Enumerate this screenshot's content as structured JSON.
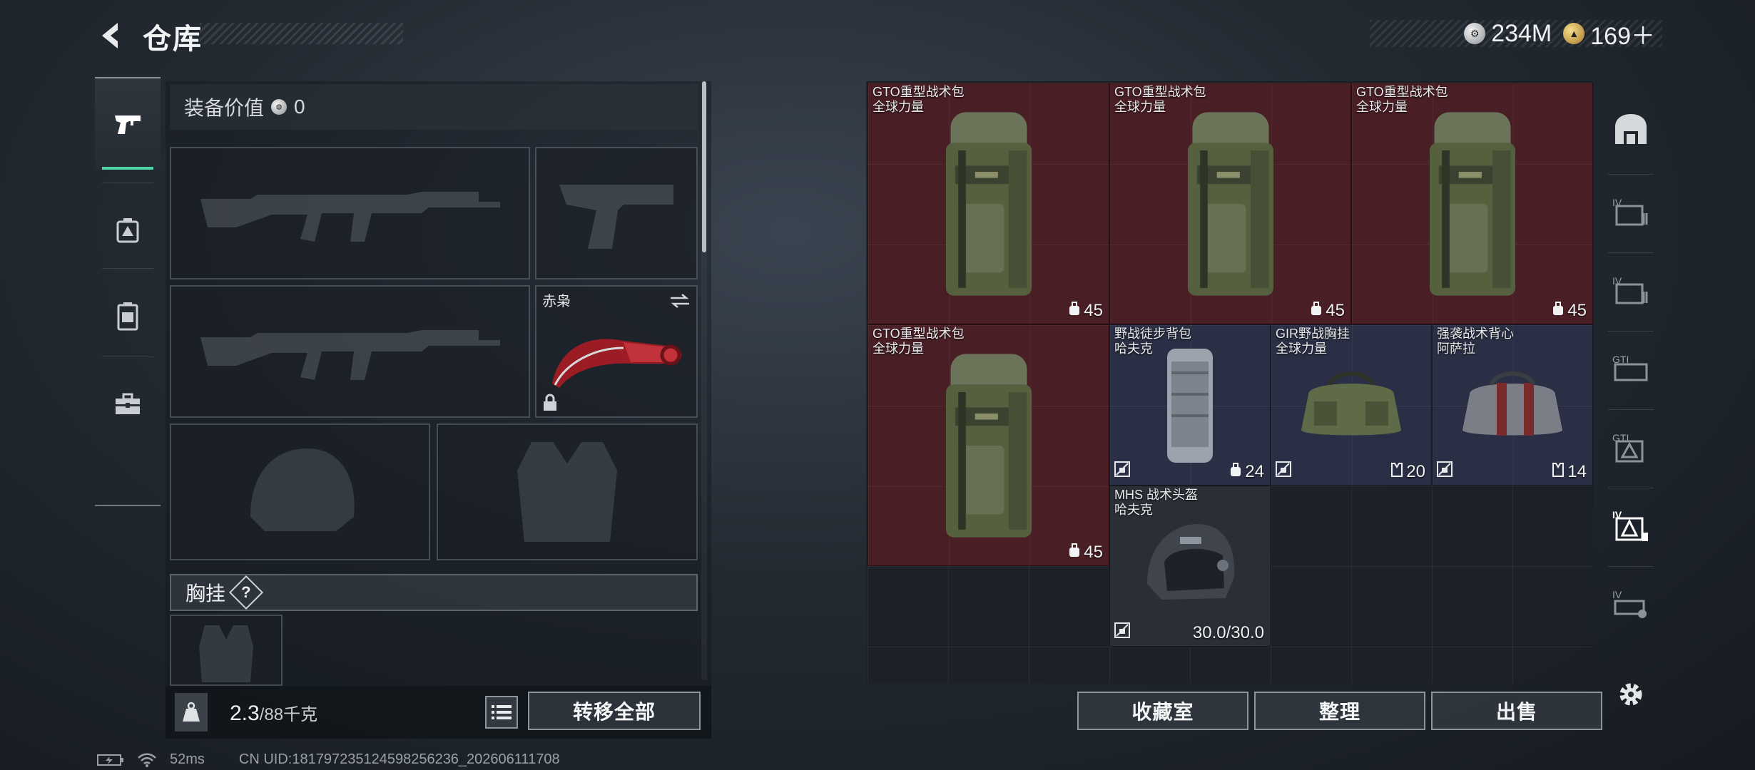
{
  "header": {
    "title": "仓库",
    "currency_silver": "234M",
    "currency_gold": "169＋"
  },
  "left_rail": {
    "items": [
      {
        "icon": "pistol-icon",
        "active": true
      },
      {
        "icon": "medkit-icon",
        "active": false
      },
      {
        "icon": "backpack-icon",
        "active": false
      },
      {
        "icon": "toolbox-icon",
        "active": false
      }
    ]
  },
  "equipment": {
    "value_label": "装备价值",
    "value": "0",
    "melee_name": "赤枭",
    "chest_rig_label": "胸挂",
    "help_symbol": "?"
  },
  "weight": {
    "current": "2.3",
    "capacity": "/88千克"
  },
  "buttons": {
    "transfer_all": "转移全部",
    "collection_room": "收藏室",
    "organize": "整理",
    "sell": "出售"
  },
  "storage_items": [
    {
      "name": "GTO重型战术包",
      "brand": "全球力量",
      "count": "45",
      "color": "red"
    },
    {
      "name": "GTO重型战术包",
      "brand": "全球力量",
      "count": "45",
      "color": "red"
    },
    {
      "name": "GTO重型战术包",
      "brand": "全球力量",
      "count": "45",
      "color": "red"
    },
    {
      "name": "GTO重型战术包",
      "brand": "全球力量",
      "count": "45",
      "color": "red"
    },
    {
      "name": "野战徒步背包",
      "brand": "哈夫克",
      "count": "24",
      "color": "blue"
    },
    {
      "name": "GIR野战胸挂",
      "brand": "全球力量",
      "count": "20",
      "color": "blue"
    },
    {
      "name": "强袭战术背心",
      "brand": "阿萨拉",
      "count": "14",
      "color": "blue"
    },
    {
      "name": "MHS 战术头盔",
      "brand": "哈夫克",
      "count": "30.0/30.0",
      "color": "dark"
    }
  ],
  "right_rail": {
    "items": [
      "home-tab",
      "storage-iv-1",
      "storage-iv-2",
      "storage-gti-1",
      "storage-gti-2",
      "storage-iv-active",
      "storage-iv-3"
    ]
  },
  "status": {
    "latency": "52ms",
    "uid": "CN UID:18179723512459825623​6_202606111708"
  },
  "colors": {
    "accent": "#4fd3a7",
    "item_red": "#4a1e25",
    "item_blue": "#2a2f45"
  }
}
